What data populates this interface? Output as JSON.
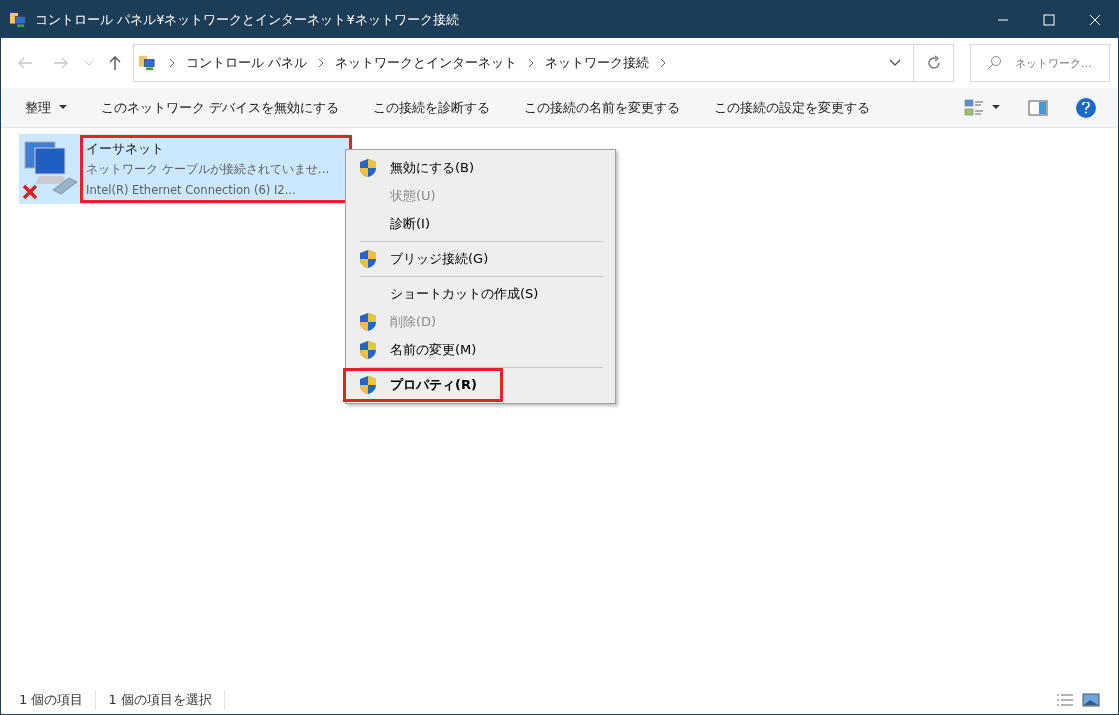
{
  "window": {
    "title": "コントロール パネル¥ネットワークとインターネット¥ネットワーク接続"
  },
  "address_bar": {
    "crumbs": [
      "コントロール パネル",
      "ネットワークとインターネット",
      "ネットワーク接続"
    ]
  },
  "search": {
    "placeholder": "ネットワーク..."
  },
  "command_bar": {
    "items": [
      {
        "label": "整理",
        "dropdown": true
      },
      {
        "label": "このネットワーク デバイスを無効にする",
        "dropdown": false
      },
      {
        "label": "この接続を診断する",
        "dropdown": false
      },
      {
        "label": "この接続の名前を変更する",
        "dropdown": false
      },
      {
        "label": "この接続の設定を変更する",
        "dropdown": false
      }
    ]
  },
  "connections": [
    {
      "name": "イーサネット",
      "status": "ネットワーク ケーブルが接続されていませ...",
      "device": "Intel(R) Ethernet Connection (6) I2...",
      "selected": true,
      "highlighted": true,
      "disconnected": true
    }
  ],
  "context_menu": {
    "items": [
      {
        "kind": "item",
        "label": "無効にする(B)",
        "shield": true,
        "disabled": false,
        "default": false,
        "highlighted": false
      },
      {
        "kind": "item",
        "label": "状態(U)",
        "shield": false,
        "disabled": true,
        "default": false,
        "highlighted": false
      },
      {
        "kind": "item",
        "label": "診断(I)",
        "shield": false,
        "disabled": false,
        "default": false,
        "highlighted": false
      },
      {
        "kind": "separator"
      },
      {
        "kind": "item",
        "label": "ブリッジ接続(G)",
        "shield": true,
        "disabled": false,
        "default": false,
        "highlighted": false
      },
      {
        "kind": "separator"
      },
      {
        "kind": "item",
        "label": "ショートカットの作成(S)",
        "shield": false,
        "disabled": false,
        "default": false,
        "highlighted": false
      },
      {
        "kind": "item",
        "label": "削除(D)",
        "shield": true,
        "disabled": true,
        "default": false,
        "highlighted": false
      },
      {
        "kind": "item",
        "label": "名前の変更(M)",
        "shield": true,
        "disabled": false,
        "default": false,
        "highlighted": false
      },
      {
        "kind": "separator"
      },
      {
        "kind": "item",
        "label": "プロパティ(R)",
        "shield": true,
        "disabled": false,
        "default": true,
        "highlighted": true
      }
    ]
  },
  "status_bar": {
    "items": [
      "1 個の項目",
      "1 個の項目を選択"
    ]
  }
}
